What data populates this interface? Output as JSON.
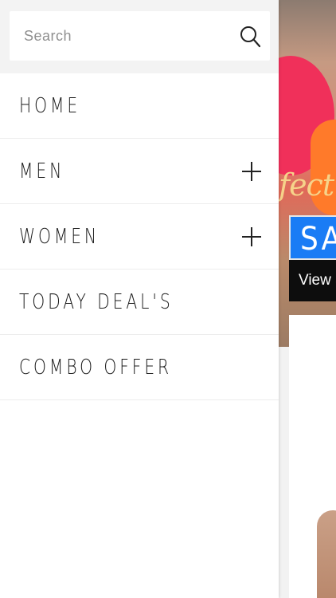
{
  "search": {
    "placeholder": "Search",
    "value": ""
  },
  "menu": {
    "items": [
      {
        "label": "HOME",
        "expandable": false
      },
      {
        "label": "MEN",
        "expandable": true
      },
      {
        "label": "WOMEN",
        "expandable": true
      },
      {
        "label": "TODAY DEAL'S",
        "expandable": false
      },
      {
        "label": "COMBO OFFER",
        "expandable": false
      }
    ]
  },
  "background": {
    "banner_script": "fect",
    "sale_text": "SA",
    "view_text": "View a"
  },
  "colors": {
    "sale_blue": "#1a7cf5",
    "view_black": "#0d0d0d",
    "divider": "#ededed"
  }
}
